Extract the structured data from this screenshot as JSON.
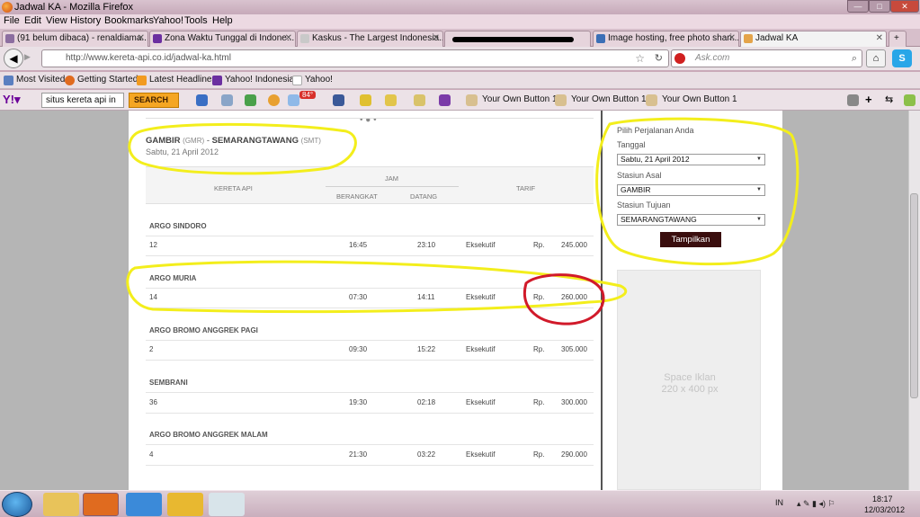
{
  "window": {
    "title": "Jadwal KA - Mozilla Firefox",
    "minimize": "—",
    "maximize": "□",
    "close": "✕"
  },
  "menu": [
    "File",
    "Edit",
    "View",
    "History",
    "Bookmarks",
    "Yahoo!",
    "Tools",
    "Help"
  ],
  "tabs": [
    {
      "label": "(91 belum dibaca) - renaldiama..."
    },
    {
      "label": "Zona Waktu Tunggal di Indone..."
    },
    {
      "label": "Kaskus - The Largest Indonesia..."
    },
    {
      "label": ""
    },
    {
      "label": "Image hosting, free photo shari..."
    },
    {
      "label": "Jadwal KA"
    }
  ],
  "nav": {
    "url": "http://www.kereta-api.co.id/jadwal-ka.html",
    "search_placeholder": "Ask.com"
  },
  "bookmarks": [
    "Most Visited",
    "Getting Started",
    "Latest Headlines",
    "Yahoo! Indonesia",
    "Yahoo!"
  ],
  "yahoo_bar": {
    "search_value": "situs kereta api in",
    "search_button": "SEARCH",
    "weather": "84°",
    "buttons": [
      "Your Own Button 1",
      "Your Own Button 1",
      "Your Own Button 1"
    ]
  },
  "schedule": {
    "route_from": "GAMBIR",
    "route_from_code": "(GMR)",
    "route_sep": "-",
    "route_to": "SEMARANGTAWANG",
    "route_to_code": "(SMT)",
    "date": "Sabtu, 21 April 2012",
    "headers": {
      "train": "KERETA API",
      "time": "JAM",
      "depart": "BERANGKAT",
      "arrive": "DATANG",
      "fare": "TARIF"
    },
    "rows": [
      {
        "name": "ARGO SINDORO",
        "number": "12",
        "depart": "16:45",
        "arrive": "23:10",
        "class": "Eksekutif",
        "currency": "Rp.",
        "fare": "245.000"
      },
      {
        "name": "ARGO MURIA",
        "number": "14",
        "depart": "07:30",
        "arrive": "14:11",
        "class": "Eksekutif",
        "currency": "Rp.",
        "fare": "260.000"
      },
      {
        "name": "ARGO BROMO ANGGREK PAGI",
        "number": "2",
        "depart": "09:30",
        "arrive": "15:22",
        "class": "Eksekutif",
        "currency": "Rp.",
        "fare": "305.000"
      },
      {
        "name": "SEMBRANI",
        "number": "36",
        "depart": "19:30",
        "arrive": "02:18",
        "class": "Eksekutif",
        "currency": "Rp.",
        "fare": "300.000"
      },
      {
        "name": "ARGO BROMO ANGGREK MALAM",
        "number": "4",
        "depart": "21:30",
        "arrive": "03:22",
        "class": "Eksekutif",
        "currency": "Rp.",
        "fare": "290.000"
      }
    ]
  },
  "sidebar": {
    "heading": "Pilih Perjalanan Anda",
    "date_label": "Tanggal",
    "date_value": "Sabtu, 21 April 2012",
    "origin_label": "Stasiun Asal",
    "origin_value": "GAMBIR",
    "dest_label": "Stasiun Tujuan",
    "dest_value": "SEMARANGTAWANG",
    "submit": "Tampilkan",
    "ad_line1": "Space Iklan",
    "ad_line2": "220 x 400 px"
  },
  "taskbar": {
    "lang": "IN",
    "time": "18:17",
    "date": "12/03/2012"
  },
  "colors": {
    "highlight_yellow": "#f3ee1c",
    "circle_red": "#d11a2a",
    "button_dark": "#3a0e0e"
  }
}
